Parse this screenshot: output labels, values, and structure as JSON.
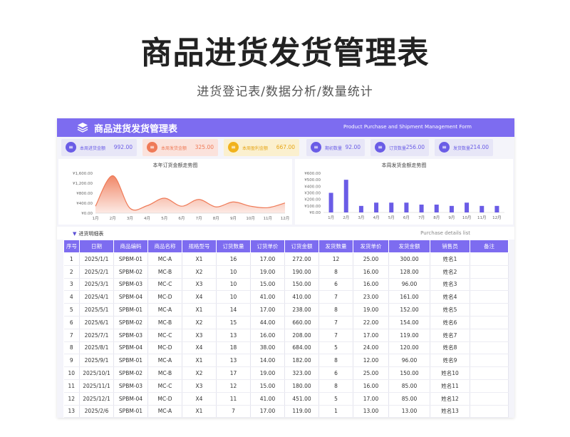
{
  "page": {
    "title": "商品进货发货管理表",
    "subtitle": "进货登记表/数据分析/数量统计"
  },
  "banner": {
    "title": "商品进货发货管理表",
    "subtitle_en": "Product Purchase and Shipment Management Form",
    "icon": "stack-icon"
  },
  "kpis": [
    {
      "label": "本周进货金额",
      "value": "992.00",
      "bg": "#e7e6f7",
      "icon_bg": "#6a5ce6",
      "color": "#6a5ce6"
    },
    {
      "label": "本周发货金额",
      "value": "325.00",
      "bg": "#fbe2dc",
      "icon_bg": "#ef7a57",
      "color": "#ef7a57"
    },
    {
      "label": "本周盈利金额",
      "value": "667.00",
      "bg": "#fbf0cf",
      "icon_bg": "#f1b21c",
      "color": "#e6a515"
    },
    {
      "label": "期初数量",
      "value": "92.00",
      "bg": "#e7e6f7",
      "icon_bg": "#6a5ce6",
      "color": "#6a5ce6"
    },
    {
      "label": "订货数量",
      "value": "256.00",
      "bg": "#e7e6f7",
      "icon_bg": "#6a5ce6",
      "color": "#6a5ce6"
    },
    {
      "label": "发货数量",
      "value": "214.00",
      "bg": "#e7e6f7",
      "icon_bg": "#6a5ce6",
      "color": "#6a5ce6"
    }
  ],
  "chart_data": [
    {
      "type": "area",
      "title": "本年订货金额走势图",
      "categories": [
        "1月",
        "2月",
        "3月",
        "4月",
        "5月",
        "6月",
        "7月",
        "8月",
        "9月",
        "10月",
        "11月",
        "12月"
      ],
      "values": [
        280,
        1500,
        200,
        300,
        600,
        280,
        550,
        250,
        450,
        280,
        220,
        410
      ],
      "ylim": [
        0,
        1600
      ],
      "yticks": [
        "¥1,600.00",
        "¥1,200.00",
        "¥800.00",
        "¥400.00",
        "¥0.00"
      ],
      "color": "#ef7a57"
    },
    {
      "type": "bar",
      "title": "本周发货金额走势图",
      "categories": [
        "1月",
        "2月",
        "3月",
        "4月",
        "5月",
        "6月",
        "7月",
        "8月",
        "9月",
        "10月",
        "11月",
        "12月"
      ],
      "values": [
        300,
        500,
        100,
        150,
        150,
        150,
        120,
        120,
        100,
        150,
        100,
        100
      ],
      "ylim": [
        0,
        600
      ],
      "yticks": [
        "¥600.00",
        "¥500.00",
        "¥400.00",
        "¥300.00",
        "¥200.00",
        "¥100.00",
        "¥0.00"
      ],
      "color": "#6a5ce6"
    }
  ],
  "detail": {
    "title": "进货明细表",
    "title_en": "Purchase details list"
  },
  "table": {
    "headers": [
      "序号",
      "日期",
      "商品编码",
      "商品名称",
      "规格型号",
      "订货数量",
      "订货单价",
      "订货金额",
      "发货数量",
      "发货单价",
      "发货金额",
      "销售员",
      "备注"
    ],
    "rows": [
      [
        "1",
        "2025/1/1",
        "SPBM-01",
        "MC-A",
        "X1",
        "16",
        "17.00",
        "272.00",
        "12",
        "25.00",
        "300.00",
        "姓名1",
        ""
      ],
      [
        "2",
        "2025/2/1",
        "SPBM-02",
        "MC-B",
        "X2",
        "10",
        "19.00",
        "190.00",
        "8",
        "16.00",
        "128.00",
        "姓名2",
        ""
      ],
      [
        "3",
        "2025/3/1",
        "SPBM-03",
        "MC-C",
        "X3",
        "10",
        "15.00",
        "150.00",
        "6",
        "16.00",
        "96.00",
        "姓名3",
        ""
      ],
      [
        "4",
        "2025/4/1",
        "SPBM-04",
        "MC-D",
        "X4",
        "10",
        "41.00",
        "410.00",
        "7",
        "23.00",
        "161.00",
        "姓名4",
        ""
      ],
      [
        "5",
        "2025/5/1",
        "SPBM-01",
        "MC-A",
        "X1",
        "14",
        "17.00",
        "238.00",
        "8",
        "19.00",
        "152.00",
        "姓名5",
        ""
      ],
      [
        "6",
        "2025/6/1",
        "SPBM-02",
        "MC-B",
        "X2",
        "15",
        "44.00",
        "660.00",
        "7",
        "22.00",
        "154.00",
        "姓名6",
        ""
      ],
      [
        "7",
        "2025/7/1",
        "SPBM-03",
        "MC-C",
        "X3",
        "13",
        "16.00",
        "208.00",
        "7",
        "17.00",
        "119.00",
        "姓名7",
        ""
      ],
      [
        "8",
        "2025/8/1",
        "SPBM-04",
        "MC-D",
        "X4",
        "18",
        "38.00",
        "684.00",
        "5",
        "24.00",
        "120.00",
        "姓名8",
        ""
      ],
      [
        "9",
        "2025/9/1",
        "SPBM-01",
        "MC-A",
        "X1",
        "13",
        "14.00",
        "182.00",
        "8",
        "12.00",
        "96.00",
        "姓名9",
        ""
      ],
      [
        "10",
        "2025/10/1",
        "SPBM-02",
        "MC-B",
        "X2",
        "17",
        "19.00",
        "323.00",
        "6",
        "25.00",
        "150.00",
        "姓名10",
        ""
      ],
      [
        "11",
        "2025/11/1",
        "SPBM-03",
        "MC-C",
        "X3",
        "12",
        "15.00",
        "180.00",
        "8",
        "16.00",
        "85.00",
        "姓名11",
        ""
      ],
      [
        "12",
        "2025/12/1",
        "SPBM-04",
        "MC-D",
        "X4",
        "11",
        "41.00",
        "451.00",
        "5",
        "17.00",
        "85.00",
        "姓名12",
        ""
      ],
      [
        "13",
        "2025/2/6",
        "SPBM-01",
        "MC-A",
        "X1",
        "7",
        "17.00",
        "119.00",
        "1",
        "13.00",
        "13.00",
        "姓名13",
        ""
      ]
    ]
  }
}
